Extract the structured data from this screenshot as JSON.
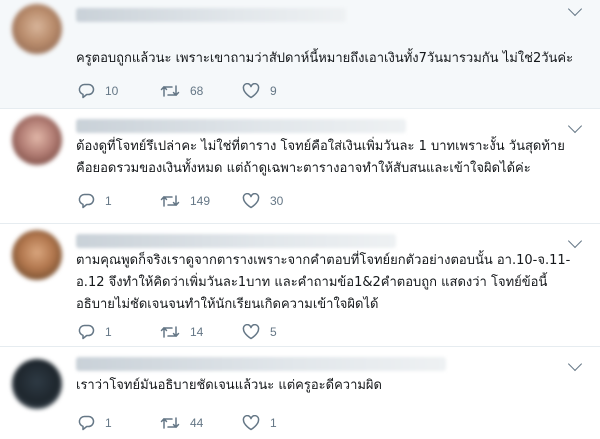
{
  "tweets": [
    {
      "text": "ครูตอบถูกแล้วนะ เพราะเขาถามว่าสัปดาห์นี้หมายถึงเอาเงินทั้ง7วันมารวมกัน ไม่ใช่2วันค่ะ",
      "replies": "10",
      "retweets": "68",
      "likes": "9"
    },
    {
      "text": "ต้องดูที่โจทย์รึเปล่าคะ ไม่ใช่ที่ตาราง โจทย์คือใส่เงินเพิ่มวันละ 1 บาทเพราะงั้น วันสุดท้าย\nคือยอดรวมของเงินทั้งหมด แต่ถ้าดูเฉพาะตารางอาจทำให้สับสนและเข้าใจผิดได้ค่ะ",
      "replies": "1",
      "retweets": "149",
      "likes": "30"
    },
    {
      "text": "ตามคุณพูดก็จริงเราดูจากตารางเพราะจากคำตอบที่โจทย์ยกตัวอย่างตอบนั้น อา.10-จ.11-\nอ.12 จึงทำให้คิดว่าเพิ่มวันละ1บาท และคำถามข้อ1&2คำตอบถูก แสดงว่า โจทย์ข้อนี้\nอธิบายไม่ชัดเจนจนทำให้นักเรียนเกิดความเข้าใจผิดได้",
      "replies": "1",
      "retweets": "14",
      "likes": "5"
    },
    {
      "text": "เราว่าโจทย์มันอธิบายชัดเจนแล้วนะ แต่ครูอะดีความผิด",
      "replies": "1",
      "retweets": "44",
      "likes": "1"
    }
  ]
}
